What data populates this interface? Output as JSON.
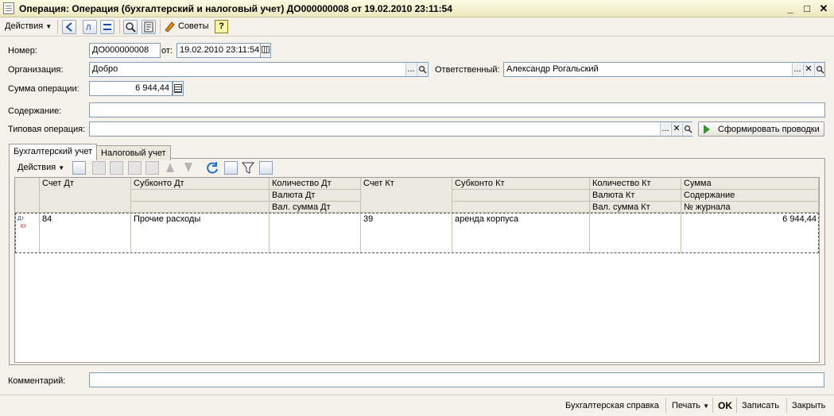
{
  "window": {
    "title": "Операция: Операция (бухгалтерский и налоговый учет) ДО000000008 от 19.02.2010 23:11:54",
    "minimize": "_",
    "maximize": "□",
    "close": "✕"
  },
  "toolbar": {
    "actions_label": "Действия",
    "tips_label": "Советы",
    "help_label": "?"
  },
  "form": {
    "number_label": "Номер:",
    "number_value": "ДО000000008",
    "date_label": "от:",
    "date_value": "19.02.2010 23:11:54",
    "org_label": "Организация:",
    "org_value": "Добро",
    "responsible_label": "Ответственный:",
    "responsible_value": "Александр Рогальский",
    "amount_label": "Сумма операции:",
    "amount_value": "6 944,44",
    "content_label": "Содержание:",
    "content_value": "",
    "typical_op_label": "Типовая операция:",
    "typical_op_value": "",
    "generate_button": "Сформировать проводки",
    "select_button": "...",
    "clear_button": "✕",
    "open_button": "🔍"
  },
  "tabs": [
    {
      "label": "Бухгалтерский учет",
      "active": true
    },
    {
      "label": "Налоговый учет",
      "active": false
    }
  ],
  "grid": {
    "actions_label": "Действия",
    "headers": {
      "debit_account": "Счет Дт",
      "debit_subconto": "Субконто Дт",
      "debit_qty": "Количество Дт",
      "debit_currency": "Валюта Дт",
      "debit_cur_amount": "Вал. сумма Дт",
      "credit_account": "Счет Кт",
      "credit_subconto": "Субконто Кт",
      "credit_qty": "Количество Кт",
      "credit_currency": "Валюта Кт",
      "credit_cur_amount": "Вал. сумма Кт",
      "sum": "Сумма",
      "content": "Содержание",
      "journal_no": "№ журнала"
    },
    "rows": [
      {
        "icon_dt": "Дт",
        "icon_kt": "Кт",
        "debit_account": "84",
        "debit_subconto": "Прочие расходы",
        "credit_account": "39",
        "credit_subconto": "аренда корпуса",
        "sum": "6 944,44"
      }
    ]
  },
  "comment": {
    "label": "Комментарий:",
    "value": ""
  },
  "bottom": {
    "report": "Бухгалтерская справка",
    "print": "Печать",
    "ok": "OK",
    "save": "Записать",
    "close": "Закрыть"
  }
}
